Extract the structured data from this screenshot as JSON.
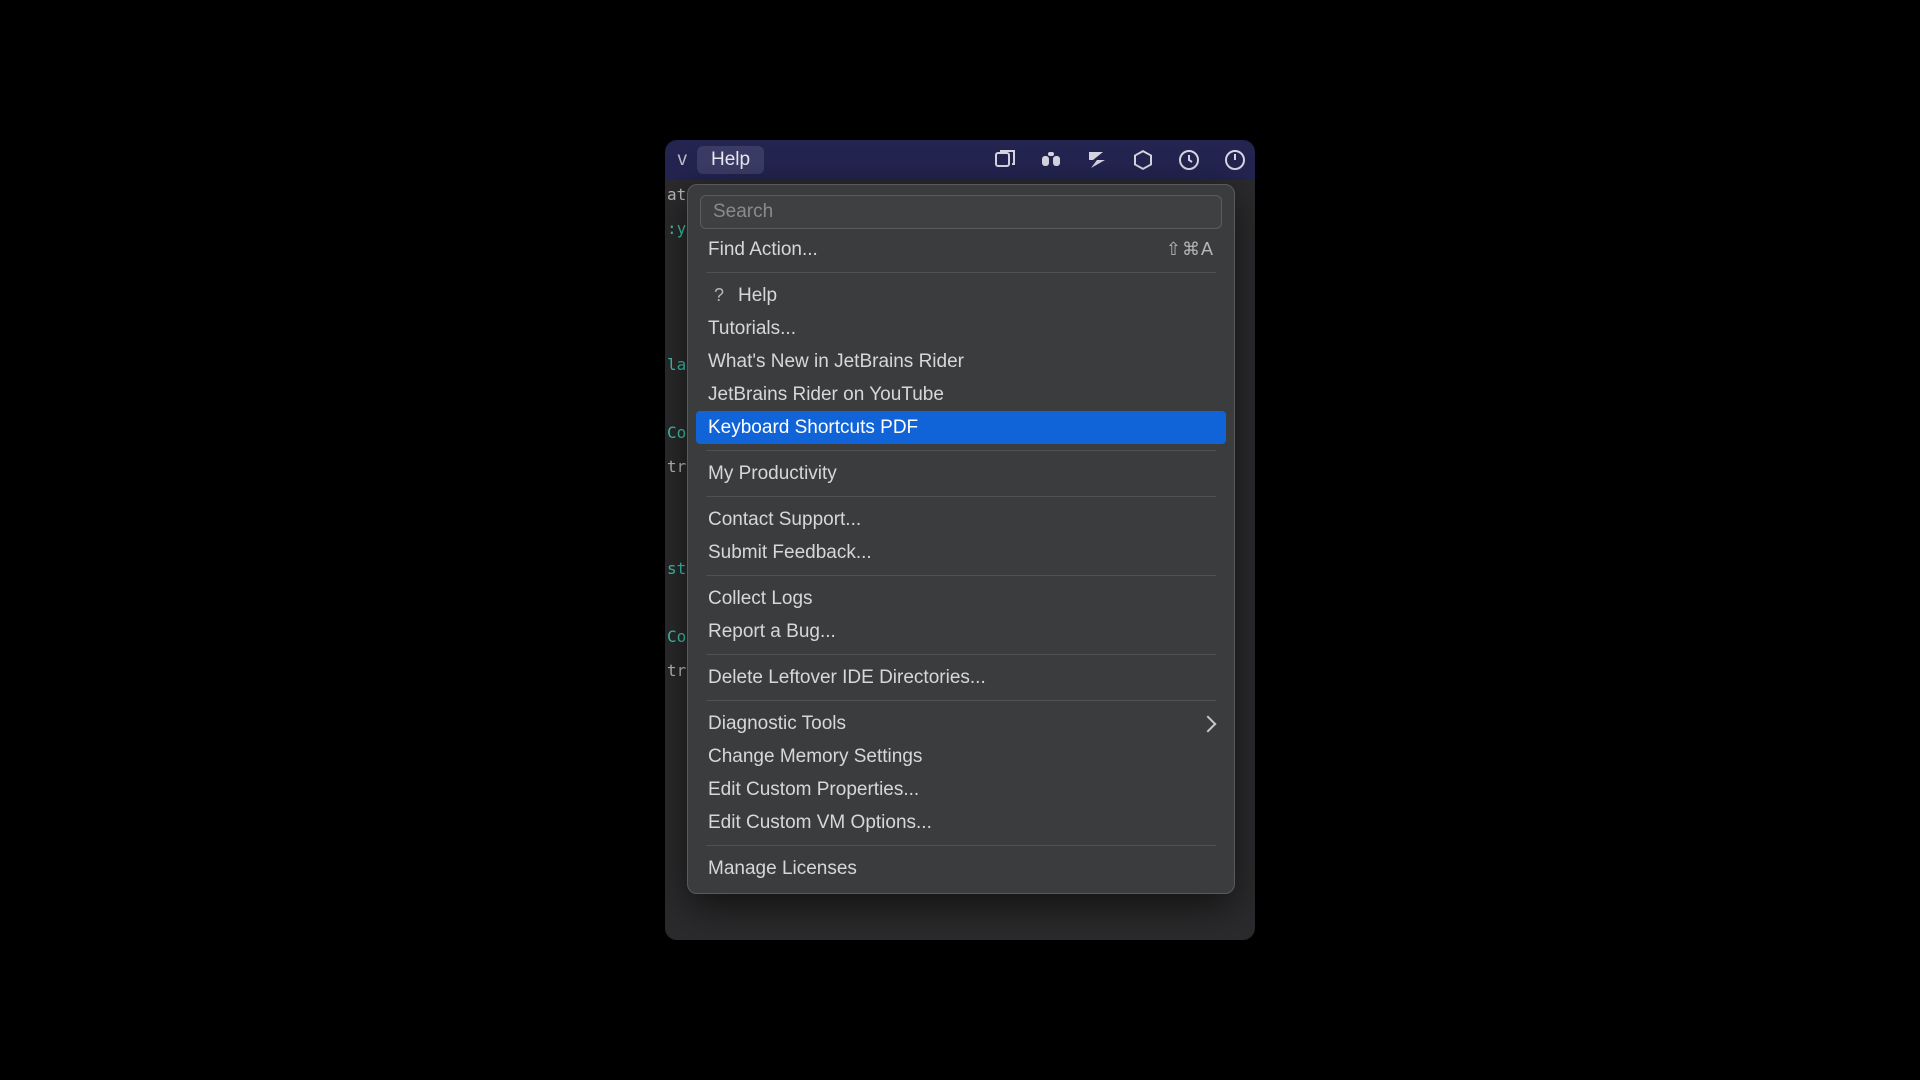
{
  "menubar": {
    "prev_fragment": "v",
    "active_label": "Help"
  },
  "dropdown": {
    "search_placeholder": "Search",
    "find_action": {
      "label": "Find Action...",
      "shortcut": "⇧⌘A"
    },
    "help": {
      "label": "Help"
    },
    "tutorials": {
      "label": "Tutorials..."
    },
    "whats_new": {
      "label": "What's New in JetBrains Rider"
    },
    "youtube": {
      "label": "JetBrains Rider on YouTube"
    },
    "shortcuts_pdf": {
      "label": "Keyboard Shortcuts PDF"
    },
    "my_productivity": {
      "label": "My Productivity"
    },
    "contact_support": {
      "label": "Contact Support..."
    },
    "submit_feedback": {
      "label": "Submit Feedback..."
    },
    "collect_logs": {
      "label": "Collect Logs"
    },
    "report_bug": {
      "label": "Report a Bug..."
    },
    "delete_leftover": {
      "label": "Delete Leftover IDE Directories..."
    },
    "diagnostic_tools": {
      "label": "Diagnostic Tools"
    },
    "change_memory": {
      "label": "Change Memory Settings"
    },
    "edit_props": {
      "label": "Edit Custom Properties..."
    },
    "edit_vm": {
      "label": "Edit Custom VM Options..."
    },
    "manage_licenses": {
      "label": "Manage Licenses"
    }
  },
  "editor_fragments": {
    "l0": "at",
    "l1": ":y",
    "l2": "",
    "l3": "",
    "l4": "",
    "l5": "la",
    "l6": "",
    "l7": "Co",
    "l8": "tr",
    "l9": "",
    "l10": "",
    "l11": "st",
    "l12": "",
    "l13": "Co",
    "l14": "tr"
  }
}
